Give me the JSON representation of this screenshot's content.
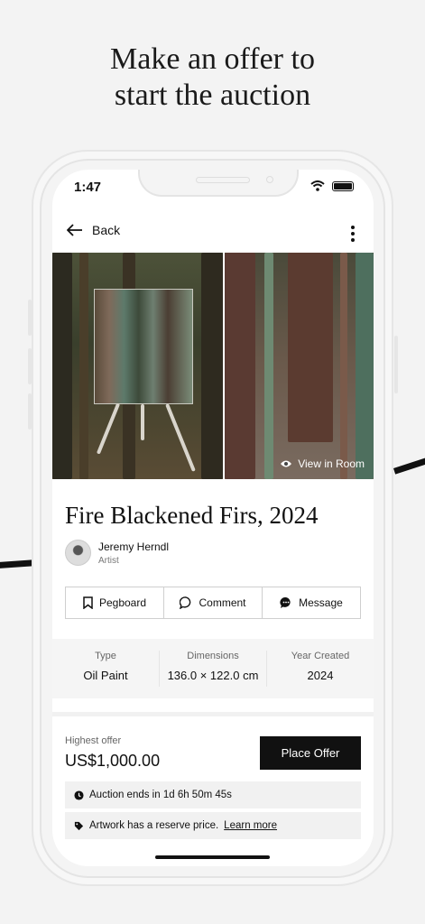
{
  "headline": {
    "line1": "Make an offer to",
    "line2": "start the auction"
  },
  "status": {
    "time": "1:47"
  },
  "nav": {
    "back_label": "Back"
  },
  "gallery": {
    "view_in_room": "View in Room"
  },
  "artwork": {
    "title": "Fire Blackened Firs, 2024"
  },
  "artist": {
    "name": "Jeremy Herndl",
    "role": "Artist"
  },
  "actions": [
    {
      "label": "Pegboard",
      "icon": "bookmark-icon"
    },
    {
      "label": "Comment",
      "icon": "comment-icon"
    },
    {
      "label": "Message",
      "icon": "message-icon"
    }
  ],
  "specs": [
    {
      "label": "Type",
      "value": "Oil Paint"
    },
    {
      "label": "Dimensions",
      "value": "136.0 × 122.0 cm"
    },
    {
      "label": "Year Created",
      "value": "2024"
    }
  ],
  "offer": {
    "label": "Highest offer",
    "amount": "US$1,000.00",
    "button": "Place Offer"
  },
  "info": {
    "auction_ends": "Auction ends in 1d 6h 50m 45s",
    "reserve_text": "Artwork has a reserve price.",
    "learn_more": "Learn more"
  }
}
